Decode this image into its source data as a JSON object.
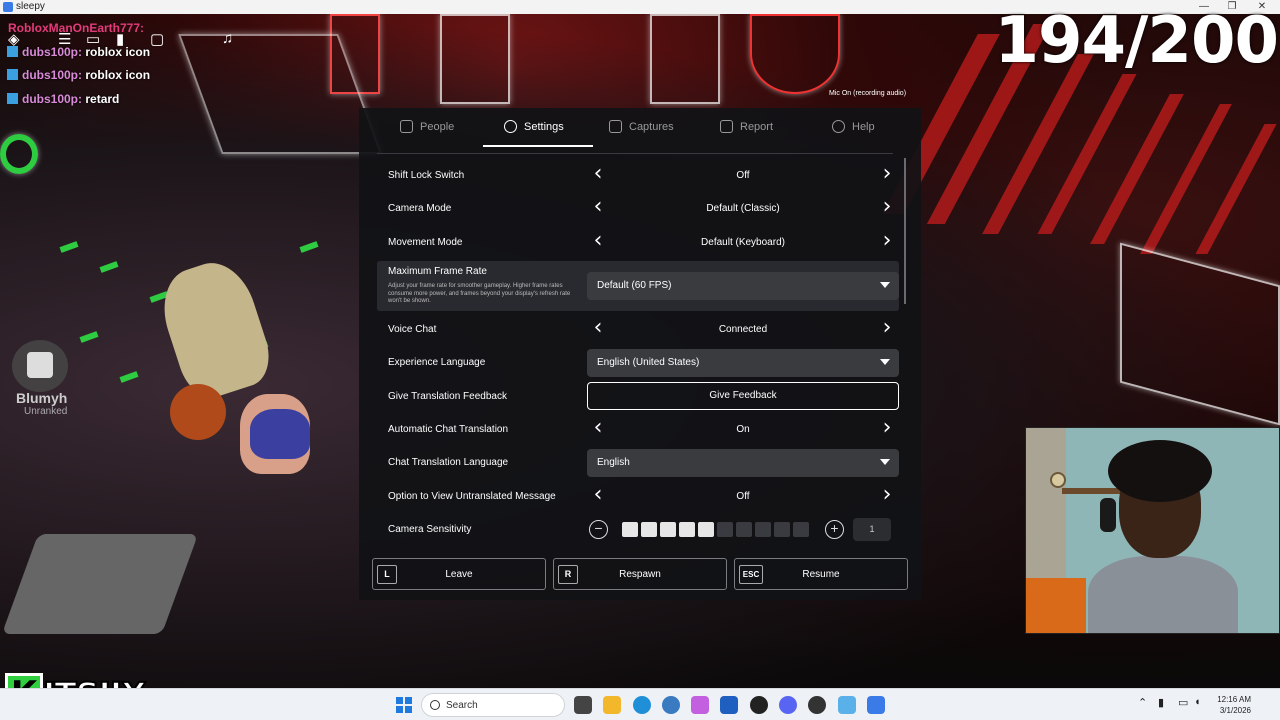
{
  "window": {
    "title": "sleepy",
    "min": "—",
    "restore": "❐",
    "close": "✕"
  },
  "game": {
    "top_player": "RobloxManOnEarth777:",
    "chat": [
      {
        "name": "dubs100p:",
        "message": "roblox icon"
      },
      {
        "name": "dubs100p:",
        "message": "roblox icon"
      },
      {
        "name": "dubs100p:",
        "message": "retard"
      }
    ],
    "counter": "194/200",
    "mic_status": "Mic On (recording audio)",
    "player_name": "Blumyh",
    "player_rank": "Unranked"
  },
  "settings": {
    "tabs": [
      {
        "label": "People",
        "icon": "people-icon"
      },
      {
        "label": "Settings",
        "icon": "gear-icon"
      },
      {
        "label": "Captures",
        "icon": "camera-icon"
      },
      {
        "label": "Report",
        "icon": "flag-icon"
      },
      {
        "label": "Help",
        "icon": "help-icon"
      }
    ],
    "shift_lock": {
      "label": "Shift Lock Switch",
      "value": "Off"
    },
    "camera_mode": {
      "label": "Camera Mode",
      "value": "Default (Classic)"
    },
    "movement_mode": {
      "label": "Movement Mode",
      "value": "Default (Keyboard)"
    },
    "frame_rate": {
      "label": "Maximum Frame Rate",
      "description": "Adjust your frame rate for smoother gameplay. Higher frame rates consume more power, and frames beyond your display's refresh rate won't be shown.",
      "value": "Default (60 FPS)"
    },
    "voice_chat": {
      "label": "Voice Chat",
      "value": "Connected"
    },
    "experience_language": {
      "label": "Experience Language",
      "value": "English (United States)"
    },
    "translation_feedback": {
      "label": "Give Translation Feedback",
      "button": "Give Feedback"
    },
    "auto_translation": {
      "label": "Automatic Chat Translation",
      "value": "On"
    },
    "translation_language": {
      "label": "Chat Translation Language",
      "value": "English"
    },
    "untranslated": {
      "label": "Option to View Untranslated Message",
      "value": "Off"
    },
    "camera_sensitivity": {
      "label": "Camera Sensitivity",
      "value": "1",
      "filled_segments": 5,
      "total_segments": 10
    },
    "actions": [
      {
        "key": "L",
        "label": "Leave"
      },
      {
        "key": "R",
        "label": "Respawn"
      },
      {
        "key": "ESC",
        "label": "Resume"
      }
    ]
  },
  "logo": {
    "letter": "K",
    "text": "ITSJJX"
  },
  "taskbar": {
    "search_placeholder": "Search",
    "time": "12:16 AM",
    "date": "3/1/2026"
  },
  "colors": {
    "accent_red": "#c41c1c",
    "logo_green": "#2fcf3f",
    "panel_bg": "#111216"
  }
}
